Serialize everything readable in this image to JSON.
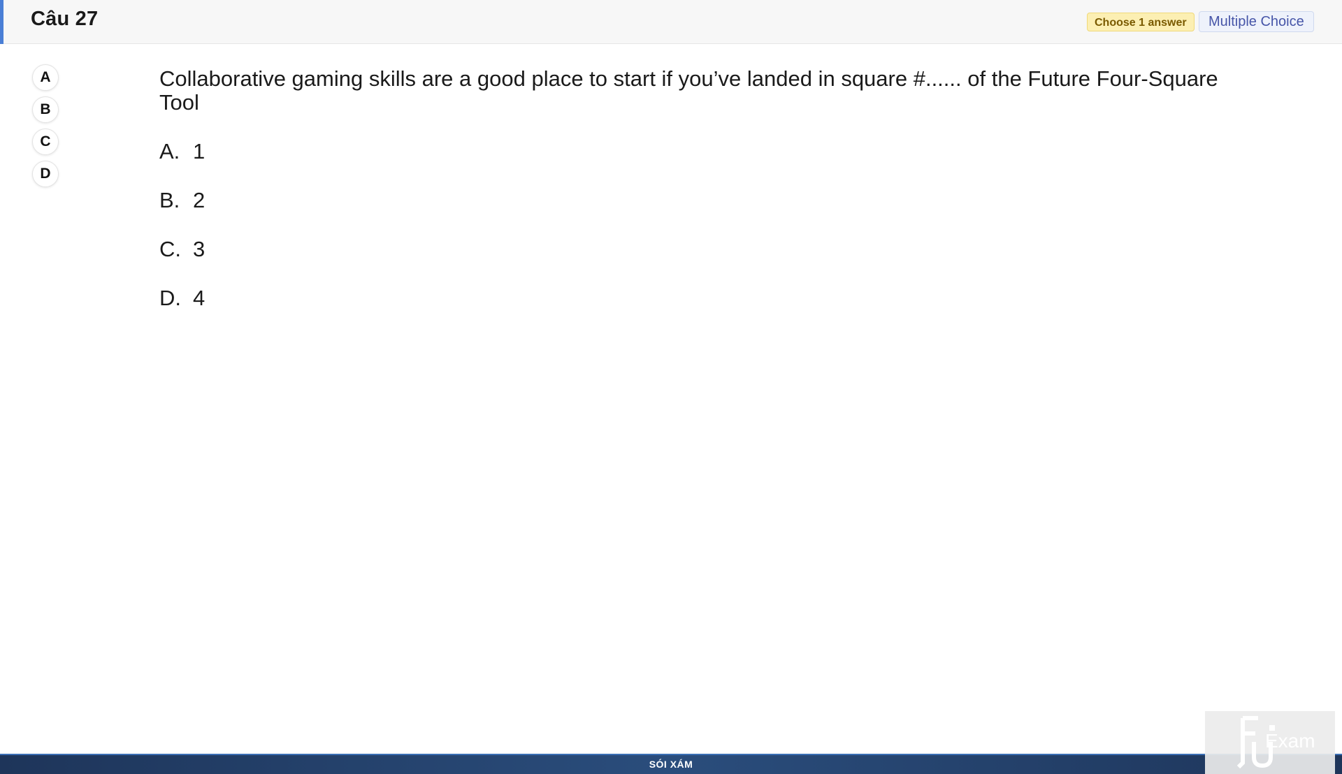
{
  "header": {
    "title": "Câu 27",
    "choose_badge": "Choose 1 answer",
    "type_badge": "Multiple Choice"
  },
  "options": [
    "A",
    "B",
    "C",
    "D"
  ],
  "question": {
    "text": "Collaborative gaming skills are a good place to start if you’ve landed in square #...... of the Future Four-Square Tool"
  },
  "answers": [
    {
      "letter": "A.",
      "text": "1"
    },
    {
      "letter": "B.",
      "text": "2"
    },
    {
      "letter": "C.",
      "text": "3"
    },
    {
      "letter": "D.",
      "text": "4"
    }
  ],
  "footer": {
    "text": "SÓI XÁM"
  },
  "logo": {
    "text": "Exam"
  },
  "colors": {
    "accent": "#4a7fd6",
    "choose_badge_bg": "#fcefb3",
    "type_badge_text": "#4655a8",
    "footer_bg": "#1e355a"
  }
}
